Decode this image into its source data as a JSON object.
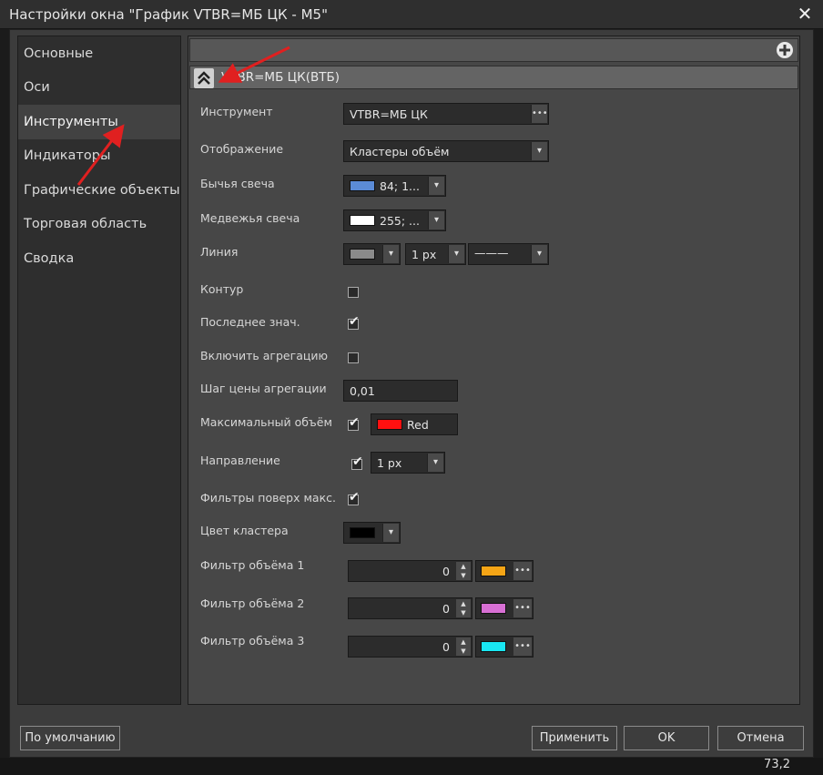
{
  "window": {
    "title": "Настройки окна \"График VTBR=МБ ЦК - M5\"",
    "close_icon": "close-icon"
  },
  "nav": {
    "items": [
      "Основные",
      "Оси",
      "Инструменты",
      "Индикаторы",
      "Графические объекты",
      "Торговая область",
      "Сводка"
    ],
    "active_index": 2
  },
  "section": {
    "header": "VTBR=МБ ЦК(ВТБ)"
  },
  "form": {
    "instrument": {
      "label": "Инструмент",
      "value": "VTBR=МБ ЦК"
    },
    "display": {
      "label": "Отображение",
      "value": "Кластеры объём"
    },
    "bull_candle": {
      "label": "Бычья свеча",
      "value": "84; 1...",
      "color": "#5b8bd6"
    },
    "bear_candle": {
      "label": "Медвежья свеча",
      "value": "255; ...",
      "color": "#ffffff"
    },
    "line": {
      "label": "Линия",
      "color": "#8a8a8a",
      "width": "1 px",
      "style": "———"
    },
    "contour": {
      "label": "Контур",
      "checked": false
    },
    "last_value": {
      "label": "Последнее знач.",
      "checked": true
    },
    "enable_aggregation": {
      "label": "Включить агрегацию",
      "checked": false
    },
    "aggregation_step": {
      "label": "Шаг цены агрегации",
      "value": "0,01"
    },
    "max_volume": {
      "label": "Максимальный объём",
      "checked": true,
      "color_name": "Red",
      "color": "#ff1010"
    },
    "direction": {
      "label": "Направление",
      "checked": true,
      "width": "1 px"
    },
    "filters_over_max": {
      "label": "Фильтры поверх макс.",
      "checked": true
    },
    "cluster_color": {
      "label": "Цвет кластера",
      "color": "#000000"
    },
    "volume_filters": [
      {
        "label": "Фильтр объёма 1",
        "value": "0",
        "color": "#f5a516"
      },
      {
        "label": "Фильтр объёма 2",
        "value": "0",
        "color": "#d86fd4"
      },
      {
        "label": "Фильтр объёма 3",
        "value": "0",
        "color": "#19e6f2"
      }
    ]
  },
  "footer": {
    "defaults_label": "По умолчанию",
    "apply_label": "Применить",
    "ok_label": "OK",
    "cancel_label": "Отмена"
  },
  "status_value": "73,2",
  "accent_color": "#e02020"
}
